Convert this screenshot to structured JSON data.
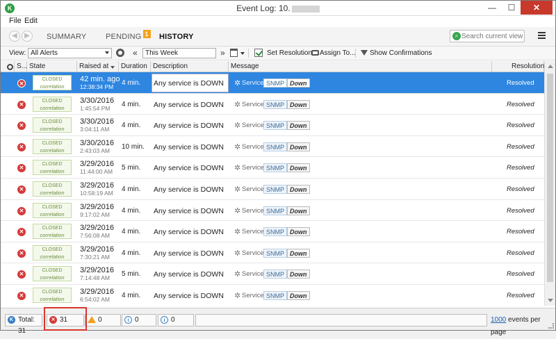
{
  "window": {
    "title": "Event Log: 10.",
    "minimize": "—",
    "maximize": "☐",
    "close": "✕"
  },
  "menu": [
    "File",
    "Edit"
  ],
  "tabs": [
    {
      "label": "SUMMARY",
      "active": false
    },
    {
      "label": "PENDING",
      "badge": "1",
      "active": false
    },
    {
      "label": "HISTORY",
      "active": true
    }
  ],
  "search": {
    "placeholder": "Search current view",
    "value": ""
  },
  "toolbar": {
    "view_label": "View:",
    "view_value": "All Alerts",
    "period_value": "This Week",
    "set_resolution": "Set Resolution",
    "assign_to": "Assign To...",
    "show_confirmations": "Show Confirmations"
  },
  "columns": [
    "S...",
    "State",
    "Raised at",
    "Duration",
    "Description",
    "Message",
    "Resolution"
  ],
  "rows": [
    {
      "state1": "CLOSED",
      "state2": "correlation",
      "raised_date": "42 min. ago",
      "raised_time": "12:38:34 PM",
      "duration": "4 min.",
      "description": "Any service is DOWN",
      "msg_type": "Service",
      "tag1": "SNMP",
      "tag2": "Down",
      "resolution": "Resolved",
      "selected": true
    },
    {
      "state1": "CLOSED",
      "state2": "correlation",
      "raised_date": "3/30/2016",
      "raised_time": "1:45:54 PM",
      "duration": "4 min.",
      "description": "Any service is DOWN",
      "msg_type": "Service",
      "tag1": "SNMP",
      "tag2": "Down",
      "resolution": "Resolved"
    },
    {
      "state1": "CLOSED",
      "state2": "correlation",
      "raised_date": "3/30/2016",
      "raised_time": "3:04:11 AM",
      "duration": "4 min.",
      "description": "Any service is DOWN",
      "msg_type": "Service",
      "tag1": "SNMP",
      "tag2": "Down",
      "resolution": "Resolved"
    },
    {
      "state1": "CLOSED",
      "state2": "correlation",
      "raised_date": "3/30/2016",
      "raised_time": "2:43:03 AM",
      "duration": "10 min.",
      "description": "Any service is DOWN",
      "msg_type": "Service",
      "tag1": "SNMP",
      "tag2": "Down",
      "resolution": "Resolved"
    },
    {
      "state1": "CLOSED",
      "state2": "correlation",
      "raised_date": "3/29/2016",
      "raised_time": "11:44:00 AM",
      "duration": "5 min.",
      "description": "Any service is DOWN",
      "msg_type": "Service",
      "tag1": "SNMP",
      "tag2": "Down",
      "resolution": "Resolved"
    },
    {
      "state1": "CLOSED",
      "state2": "correlation",
      "raised_date": "3/29/2016",
      "raised_time": "10:58:19 AM",
      "duration": "4 min.",
      "description": "Any service is DOWN",
      "msg_type": "Service",
      "tag1": "SNMP",
      "tag2": "Down",
      "resolution": "Resolved"
    },
    {
      "state1": "CLOSED",
      "state2": "correlation",
      "raised_date": "3/29/2016",
      "raised_time": "9:17:02 AM",
      "duration": "4 min.",
      "description": "Any service is DOWN",
      "msg_type": "Service",
      "tag1": "SNMP",
      "tag2": "Down",
      "resolution": "Resolved"
    },
    {
      "state1": "CLOSED",
      "state2": "correlation",
      "raised_date": "3/29/2016",
      "raised_time": "7:56:08 AM",
      "duration": "4 min.",
      "description": "Any service is DOWN",
      "msg_type": "Service",
      "tag1": "SNMP",
      "tag2": "Down",
      "resolution": "Resolved"
    },
    {
      "state1": "CLOSED",
      "state2": "correlation",
      "raised_date": "3/29/2016",
      "raised_time": "7:30:21 AM",
      "duration": "4 min.",
      "description": "Any service is DOWN",
      "msg_type": "Service",
      "tag1": "SNMP",
      "tag2": "Down",
      "resolution": "Resolved"
    },
    {
      "state1": "CLOSED",
      "state2": "correlation",
      "raised_date": "3/29/2016",
      "raised_time": "7:14:48 AM",
      "duration": "5 min.",
      "description": "Any service is DOWN",
      "msg_type": "Service",
      "tag1": "SNMP",
      "tag2": "Down",
      "resolution": "Resolved"
    },
    {
      "state1": "CLOSED",
      "state2": "correlation",
      "raised_date": "3/29/2016",
      "raised_time": "6:54:02 AM",
      "duration": "4 min.",
      "description": "Any service is DOWN",
      "msg_type": "Service",
      "tag1": "SNMP",
      "tag2": "Down",
      "resolution": "Resolved"
    }
  ],
  "status": {
    "total": "Total: 31",
    "errors": "31",
    "warnings": "0",
    "info": "0",
    "other": "0",
    "per_page_value": "1000",
    "per_page_suffix": " events per page"
  },
  "colors": {
    "selected_row": "#2e86e0",
    "error": "#d63a3a",
    "badge": "#f4a11a",
    "highlight": "#d9352b"
  }
}
